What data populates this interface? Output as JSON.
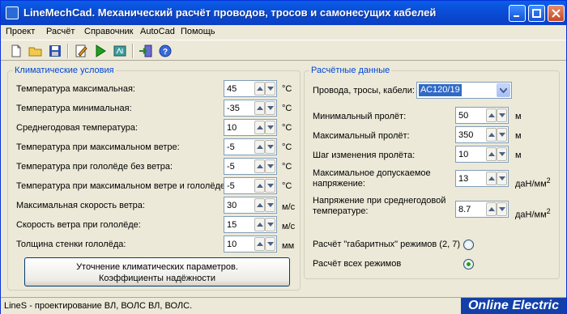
{
  "window": {
    "title": "LineMechCad. Механический расчёт проводов, тросов и самонесущих кабелей"
  },
  "menu": [
    "Проект",
    "Расчёт",
    "Справочник",
    "AutoCad",
    "Помощь"
  ],
  "toolbar": {
    "icons": [
      "new-file-icon",
      "open-folder-icon",
      "save-icon",
      "edit-icon",
      "run-icon",
      "export-icon",
      "exit-icon",
      "help-icon"
    ]
  },
  "climate": {
    "title": "Климатические условия",
    "rows": [
      {
        "label": "Температура максимальная:",
        "value": "45",
        "unit": "°C"
      },
      {
        "label": "Температура минимальная:",
        "value": "-35",
        "unit": "°C"
      },
      {
        "label": "Среднегодовая температура:",
        "value": "10",
        "unit": "°C"
      },
      {
        "label": "Температура при максимальном ветре:",
        "value": "-5",
        "unit": "°C"
      },
      {
        "label": "Температура при гололёде без ветра:",
        "value": "-5",
        "unit": "°C"
      },
      {
        "label": "Температура при максимальном ветре и гололёде:",
        "value": "-5",
        "unit": "°C"
      },
      {
        "label": "Максимальная скорость ветра:",
        "value": "30",
        "unit": "м/с"
      },
      {
        "label": "Скорость ветра при гололёде:",
        "value": "15",
        "unit": "м/с"
      },
      {
        "label": "Толщина стенки гололёда:",
        "value": "10",
        "unit": "мм"
      }
    ],
    "refine_button_line1": "Уточнение климатических параметров.",
    "refine_button_line2": "Коэффициенты надёжности"
  },
  "calc": {
    "title": "Расчётные данные",
    "wire_label": "Провода, тросы, кабели:",
    "wire_value": "АС120/19",
    "min_span_label": "Минимальный пролёт:",
    "min_span_value": "50",
    "min_span_unit": "м",
    "max_span_label": "Максимальный пролёт:",
    "max_span_value": "350",
    "max_span_unit": "м",
    "step_label": "Шаг изменения пролёта:",
    "step_value": "10",
    "step_unit": "м",
    "max_stress_label_1": "Максимальное допускаемое",
    "max_stress_label_2": "напряжение:",
    "max_stress_value": "13",
    "avg_stress_label_1": "Напряжение при среднегодовой",
    "avg_stress_label_2": "температуре:",
    "avg_stress_value": "8.7",
    "stress_unit": "даН/мм",
    "stress_unit_sup": "2",
    "radio_gabarit": "Расчёт \"габаритных\" режимов (2, 7)",
    "radio_all": "Расчёт всех режимов",
    "radio_selected": "all"
  },
  "status": {
    "text": "LineS - проектирование ВЛ, ВОЛС ВЛ, ВОЛС.",
    "brand": "Online Electric"
  }
}
